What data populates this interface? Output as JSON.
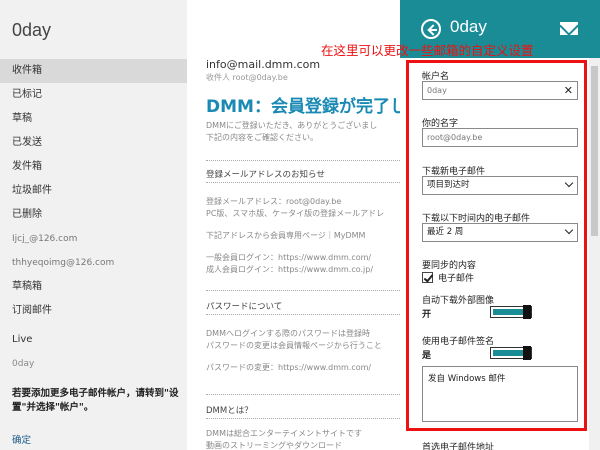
{
  "left": {
    "account_title": "0day",
    "folders": [
      {
        "label": "收件箱",
        "selected": true
      },
      {
        "label": "已标记"
      },
      {
        "label": "草稿"
      },
      {
        "label": "已发送"
      },
      {
        "label": "发件箱"
      },
      {
        "label": "垃圾邮件"
      },
      {
        "label": "已删除"
      },
      {
        "label": "Ijcj_@126.com",
        "blurry": true
      },
      {
        "label": "thhyeqoimg@126.com",
        "blurry": true
      },
      {
        "label": "草稿箱"
      },
      {
        "label": "订阅邮件"
      }
    ],
    "accounts": [
      {
        "label": "Live"
      },
      {
        "label": "0day",
        "blurry": true
      }
    ],
    "hint": "若要添加更多电子邮件帐户，请转到\"设置\"并选择\"帐户\"。",
    "ok_label": "确定"
  },
  "message": {
    "from": "info@mail.dmm.com",
    "to": "收件人 root@0day.be",
    "subject": "DMM：会員登録が完了し",
    "intro_1": "DMMにご登録いただき、ありがとうございまし",
    "intro_2": "下記の内容をご確認ください。",
    "section_1": "登録メールアドレスのお知らせ",
    "s1_line_1": "登録メールアドレス：root@0day.be",
    "s1_line_2": "PC版、スマホ版、ケータイ版の登録メールアドレ",
    "s1_line_3": "下記アドレスから会員専用ページ｜MyDMM",
    "s1_line_4": "一般会員ログイン：https://www.dmm.com/",
    "s1_line_5": "成人会員ログイン：https://www.dmm.co.jp/",
    "section_2": "パスワードについて",
    "s2_line_1": "DMMへログインする際のパスワードは登録時",
    "s2_line_2": "パスワードの変更は会員情報ページから行うこと",
    "s2_line_3": "パスワードの変更：https://www.dmm.com/",
    "section_3": "DMMとは？",
    "s3_line_1": "DMMは総合エンターテイメントサイトです",
    "s3_line_2": "動画のストリーミングやダウンロード"
  },
  "settings": {
    "title": "0day",
    "annotation": "在这里可以更改一些邮箱的自定义设置",
    "account_name_label": "帐户名",
    "account_name_value": "0day",
    "your_name_label": "你的名字",
    "your_name_value": "root@0day.be",
    "download_new_label": "下载新电子邮件",
    "download_new_value": "项目到达时",
    "download_range_label": "下载以下时间内的电子邮件",
    "download_range_value": "最近 2 周",
    "sync_label": "要同步的内容",
    "sync_email_label": "电子邮件",
    "auto_images_label": "自动下载外部图像",
    "auto_images_state": "开",
    "auto_images_on": true,
    "signature_label": "使用电子邮件签名",
    "signature_state": "是",
    "signature_on": true,
    "signature_text": "发自 Windows 邮件",
    "bottom_label": "首选电子邮件地址",
    "colors": {
      "accent": "#1a8c96",
      "annotation": "#e11111"
    }
  }
}
